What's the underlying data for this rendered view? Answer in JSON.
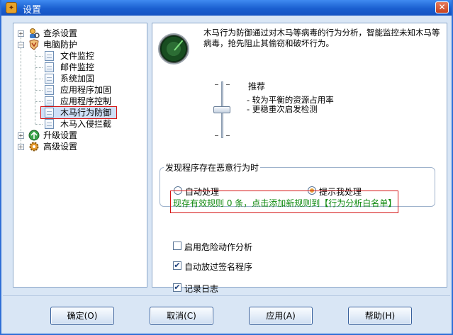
{
  "window": {
    "title": "设置"
  },
  "tree": {
    "items": [
      {
        "label": "查杀设置",
        "level": 0,
        "expander": "+"
      },
      {
        "label": "电脑防护",
        "level": 0,
        "expander": "-"
      },
      {
        "label": "文件监控",
        "level": 1
      },
      {
        "label": "邮件监控",
        "level": 1
      },
      {
        "label": "系统加固",
        "level": 1
      },
      {
        "label": "应用程序加固",
        "level": 1
      },
      {
        "label": "应用程序控制",
        "level": 1
      },
      {
        "label": "木马行为防御",
        "level": 1,
        "selected": true
      },
      {
        "label": "木马入侵拦截",
        "level": 1
      },
      {
        "label": "升级设置",
        "level": 0,
        "expander": "+"
      },
      {
        "label": "高级设置",
        "level": 0,
        "expander": "+"
      }
    ]
  },
  "main": {
    "description": "木马行为防御通过对木马等病毒的行为分析，智能监控未知木马等病毒，抢先阻止其偷窃和破坏行为。",
    "level_title": "推荐",
    "level_desc_1": "- 较为平衡的资源占用率",
    "level_desc_2": "- 更稳重次启发检测",
    "group_title": "发现程序存在恶意行为时",
    "radio_auto": "自动处理",
    "radio_prompt": "提示我处理",
    "radio_selected": "prompt",
    "rule_text": "现存有效规则 0 条，点击添加新规则到【行为分析白名单】",
    "check_danger": "启用危险动作分析",
    "check_sign": "自动放过签名程序",
    "check_log": "记录日志",
    "check_states": {
      "danger": false,
      "sign": true,
      "log": true
    }
  },
  "buttons": {
    "ok": "确定(O)",
    "cancel": "取消(C)",
    "apply": "应用(A)",
    "help": "帮助(H)"
  },
  "colors": {
    "title_bar": "#1a5fd0",
    "rule_text": "#108a10",
    "highlight_border": "#d51313"
  }
}
